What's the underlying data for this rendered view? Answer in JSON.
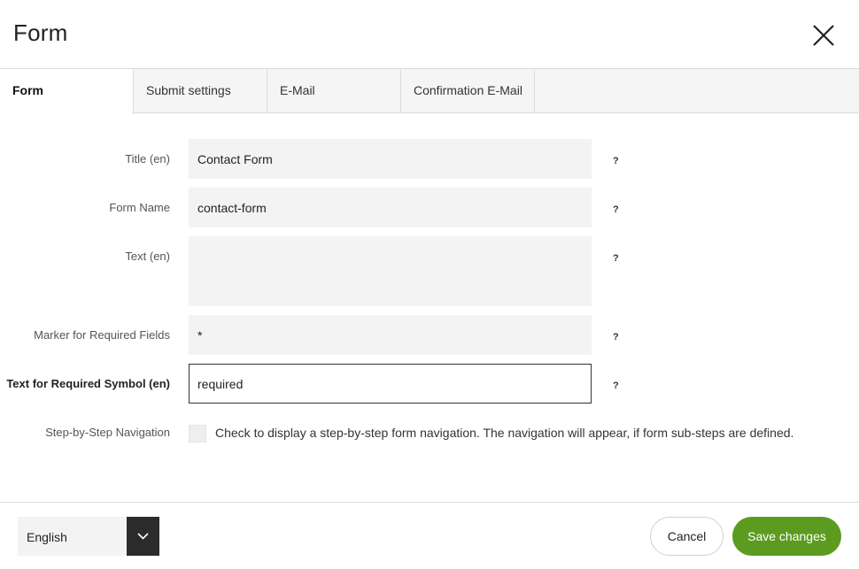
{
  "dialog": {
    "title": "Form"
  },
  "tabs": [
    {
      "label": "Form",
      "active": true
    },
    {
      "label": "Submit settings",
      "active": false
    },
    {
      "label": "E-Mail",
      "active": false
    },
    {
      "label": "Confirmation E-Mail",
      "active": false
    }
  ],
  "fields": {
    "title": {
      "label": "Title (en)",
      "value": "Contact Form",
      "help": "?"
    },
    "form_name": {
      "label": "Form Name",
      "value": "contact-form",
      "help": "?"
    },
    "text": {
      "label": "Text (en)",
      "value": "",
      "help": "?"
    },
    "required_marker": {
      "label": "Marker for Required Fields",
      "value": "*",
      "help": "?"
    },
    "required_symbol_text": {
      "label": "Text for Required Symbol (en)",
      "value": "required",
      "help": "?"
    },
    "step_navigation": {
      "label": "Step-by-Step Navigation",
      "checked": false,
      "description": "Check to display a step-by-step form navigation. The navigation will appear, if form sub-steps are defined."
    }
  },
  "footer": {
    "language": "English",
    "cancel_label": "Cancel",
    "save_label": "Save changes"
  },
  "colors": {
    "accent": "#5c9b1f",
    "dark": "#2b2b2b"
  },
  "icons": {
    "close": "close-icon",
    "chevron": "chevron-down-icon"
  }
}
